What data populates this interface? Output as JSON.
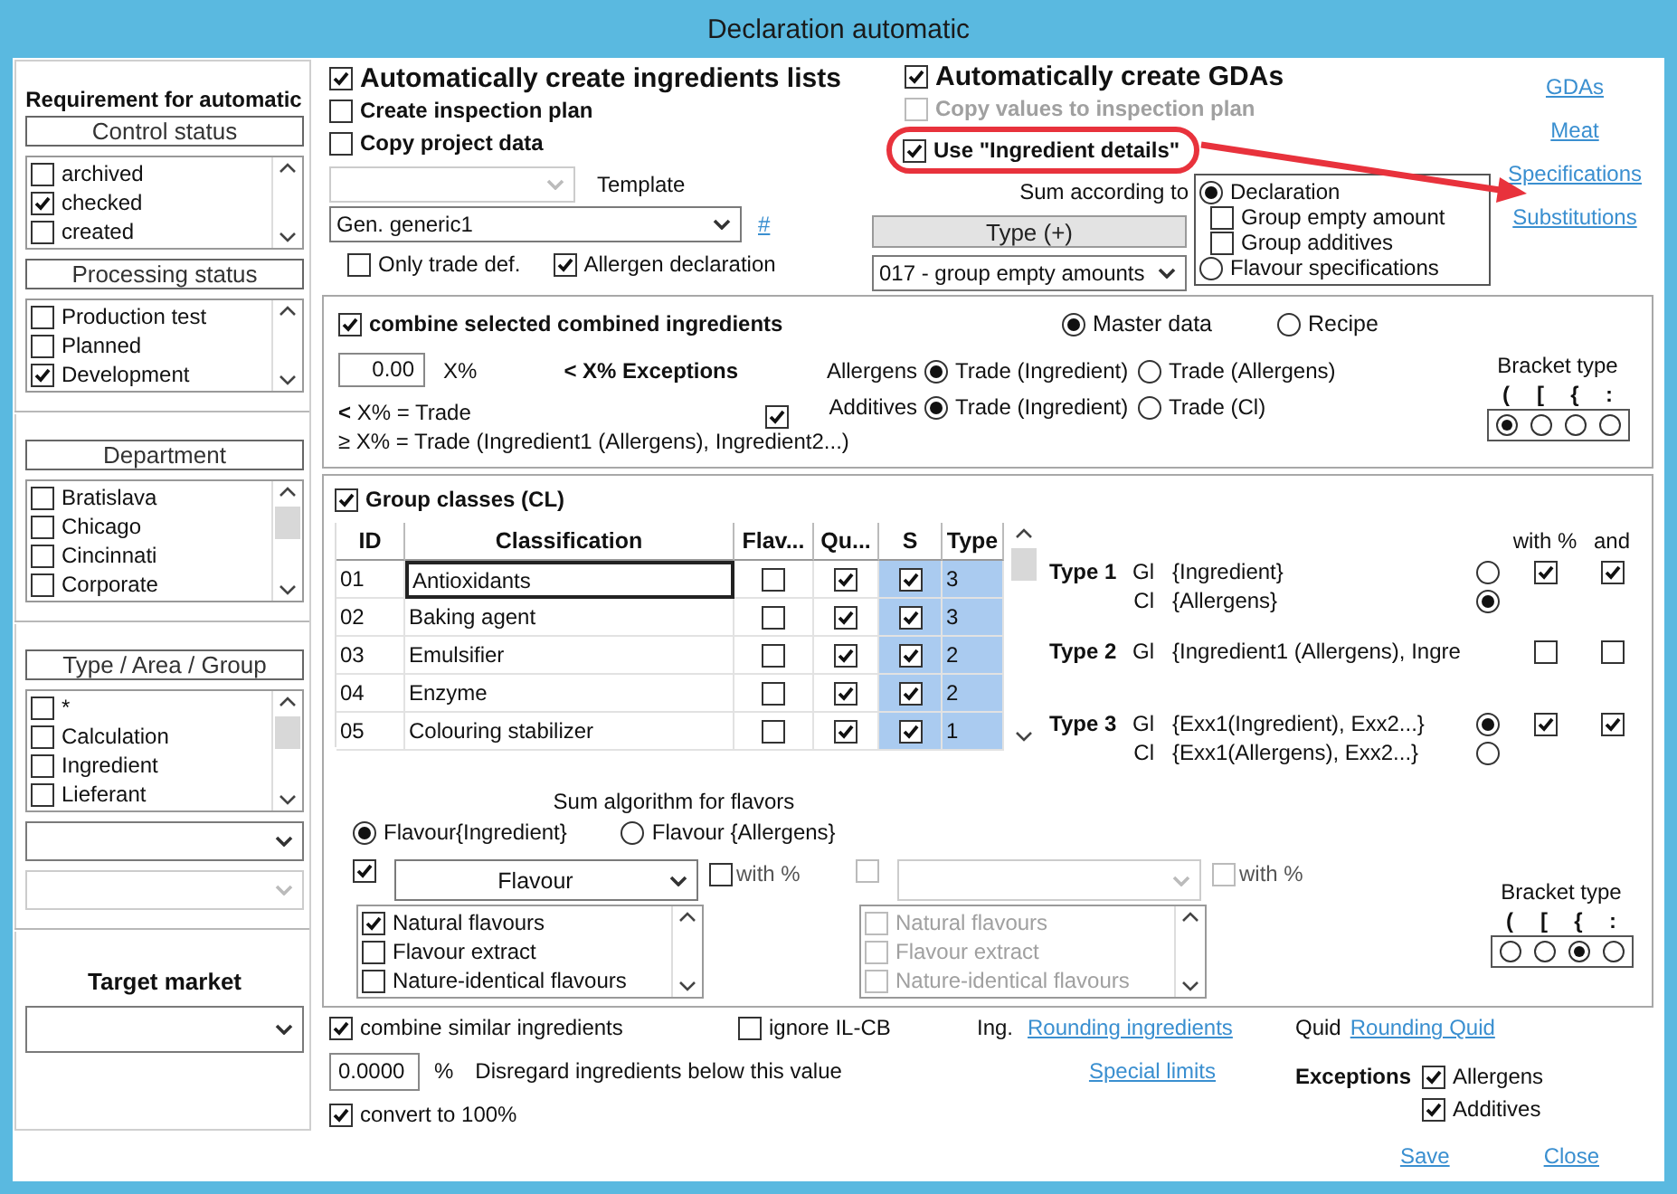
{
  "window": {
    "title": "Declaration automatic"
  },
  "requirements": {
    "title": "Requirement for automatic",
    "sections": [
      {
        "lists": [
          {
            "title": "Control status",
            "items": [
              {
                "label": "archived",
                "checked": false
              },
              {
                "label": "checked",
                "checked": true
              },
              {
                "label": "created",
                "checked": false
              }
            ]
          },
          {
            "title": "Processing status",
            "items": [
              {
                "label": "Production test",
                "checked": false
              },
              {
                "label": "Planned",
                "checked": false
              },
              {
                "label": "Development",
                "checked": true
              }
            ]
          }
        ]
      },
      {
        "lists": [
          {
            "title": "Department",
            "items": [
              {
                "label": "Bratislava",
                "checked": false
              },
              {
                "label": "Chicago",
                "checked": false
              },
              {
                "label": "Cincinnati",
                "checked": false
              },
              {
                "label": "Corporate",
                "checked": false
              }
            ]
          }
        ]
      },
      {
        "lists": [
          {
            "title": "Type / Area / Group",
            "items": [
              {
                "label": "*",
                "checked": false
              },
              {
                "label": "Calculation",
                "checked": false
              },
              {
                "label": "Ingredient",
                "checked": false
              },
              {
                "label": "Lieferant",
                "checked": false
              }
            ]
          }
        ],
        "dropdowns": [
          {
            "disabled": false
          },
          {
            "disabled": true
          }
        ]
      }
    ],
    "target_market": {
      "title": "Target market"
    }
  },
  "general": {
    "create_options": [
      {
        "label": "Automatically create ingredients lists",
        "checked": true,
        "kind": "primary"
      },
      {
        "label": "Create inspection plan",
        "checked": false,
        "kind": "secondary"
      },
      {
        "label": "Copy project data",
        "checked": false,
        "kind": "secondary"
      }
    ],
    "template": {
      "label": "Template",
      "disabled": true
    },
    "template_select": {
      "value": "Gen. generic1",
      "link": "#"
    },
    "flags": [
      {
        "label": "Only trade def.",
        "checked": false
      },
      {
        "label": "Allergen declaration",
        "checked": true
      }
    ],
    "gda_options": [
      {
        "label": "Automatically create GDAs",
        "checked": true,
        "disabled": false,
        "highlighted": false,
        "kind": "primary"
      },
      {
        "label": "Copy values to inspection plan",
        "checked": false,
        "disabled": true,
        "highlighted": false,
        "kind": "secondary"
      },
      {
        "label": "Use \"Ingredient details\"",
        "checked": true,
        "disabled": false,
        "highlighted": true,
        "kind": "secondary"
      }
    ],
    "sum_according": {
      "label": "Sum according to",
      "options": [
        {
          "kind": "radio",
          "label": "Declaration",
          "selected": true
        },
        {
          "kind": "checkbox",
          "label": "Group empty amount",
          "checked": false
        },
        {
          "kind": "checkbox",
          "label": "Group additives",
          "checked": false
        },
        {
          "kind": "radio",
          "label": "Flavour specifications",
          "selected": false
        }
      ]
    },
    "type_button": "Type (+)",
    "type_select": "017 - group empty amounts",
    "links": [
      "GDAs",
      "Meat",
      "Specifications",
      "Substitutions"
    ]
  },
  "combine": {
    "label": "combine selected combined ingredients",
    "checked": true,
    "source": [
      {
        "label": "Master data",
        "selected": true
      },
      {
        "label": "Recipe",
        "selected": false
      }
    ],
    "threshold": {
      "value": "0.00",
      "unit": "X%"
    },
    "exceptions_title": "< X% Exceptions",
    "rules": [
      "**<** X% = Trade",
      "≥ X% = Trade (Ingredient1 (Allergens), Ingredient2...)"
    ],
    "exceptions_checked": true,
    "allocations": [
      {
        "label": "Allergens",
        "options": [
          {
            "label": "Trade (Ingredient)",
            "selected": true
          },
          {
            "label": "Trade (Allergens)",
            "selected": false
          }
        ]
      },
      {
        "label": "Additives",
        "options": [
          {
            "label": "Trade (Ingredient)",
            "selected": true
          },
          {
            "label": "Trade (Cl)",
            "selected": false
          }
        ]
      }
    ],
    "bracket": {
      "title": "Bracket type",
      "options": [
        {
          "label": "(",
          "selected": true
        },
        {
          "label": "[",
          "selected": false
        },
        {
          "label": "{",
          "selected": false
        },
        {
          "label": ":",
          "selected": false
        }
      ]
    }
  },
  "group_classes": {
    "label": "Group classes (CL)",
    "checked": true,
    "table": {
      "columns": [
        "ID",
        "Classification",
        "Flav...",
        "Qu...",
        "S",
        "Type"
      ],
      "rows": [
        {
          "id": "01",
          "classification": "Antioxidants",
          "flavour": false,
          "quid": true,
          "s": true,
          "type": "3",
          "selected": true
        },
        {
          "id": "02",
          "classification": "Baking agent",
          "flavour": false,
          "quid": true,
          "s": true,
          "type": "3",
          "selected": false
        },
        {
          "id": "03",
          "classification": "Emulsifier",
          "flavour": false,
          "quid": true,
          "s": true,
          "type": "2",
          "selected": false
        },
        {
          "id": "04",
          "classification": "Enzyme",
          "flavour": false,
          "quid": true,
          "s": true,
          "type": "2",
          "selected": false
        },
        {
          "id": "05",
          "classification": "Colouring stabilizer",
          "flavour": false,
          "quid": true,
          "s": true,
          "type": "1",
          "selected": false
        }
      ]
    },
    "type_rules": {
      "headers": [
        "with %",
        "and"
      ],
      "types": [
        {
          "label": "Type 1",
          "lines": [
            {
              "code": "Gl",
              "text": "{Ingredient}",
              "selected": false,
              "with_percent": true,
              "and": true
            },
            {
              "code": "Cl",
              "text": "{Allergens}",
              "selected": true
            }
          ]
        },
        {
          "label": "Type 2",
          "lines": [
            {
              "code": "Gl",
              "text": "{Ingredient1 (Allergens), Ingre",
              "with_percent": false,
              "and": false
            }
          ]
        },
        {
          "label": "Type 3",
          "lines": [
            {
              "code": "Gl",
              "text": "{Exx1(Ingredient), Exx2...}",
              "selected": true,
              "with_percent": true,
              "and": true
            },
            {
              "code": "Cl",
              "text": "{Exx1(Allergens), Exx2...}",
              "selected": false
            }
          ]
        }
      ]
    }
  },
  "flavours": {
    "title": "Sum algorithm for flavors",
    "algorithm": [
      {
        "label": "Flavour{Ingredient}",
        "selected": true
      },
      {
        "label": "Flavour {Allergens}",
        "selected": false
      }
    ],
    "columns": [
      {
        "checked": true,
        "disabled": false,
        "value": "Flavour",
        "with_percent": {
          "label": "with %",
          "checked": false
        },
        "items": [
          {
            "label": "Natural flavours",
            "checked": true
          },
          {
            "label": "Flavour extract",
            "checked": false
          },
          {
            "label": "Nature-identical flavours",
            "checked": false
          }
        ]
      },
      {
        "checked": false,
        "disabled": true,
        "with_percent": {
          "label": "with %",
          "checked": false
        },
        "items": [
          {
            "label": "Natural flavours",
            "checked": false
          },
          {
            "label": "Flavour extract",
            "checked": false
          },
          {
            "label": "Nature-identical flavours",
            "checked": false
          }
        ]
      }
    ],
    "bracket": {
      "title": "Bracket type",
      "options": [
        {
          "label": "(",
          "selected": false
        },
        {
          "label": "[",
          "selected": false
        },
        {
          "label": "{",
          "selected": true
        },
        {
          "label": ":",
          "selected": false
        }
      ]
    }
  },
  "bottom": {
    "options": [
      {
        "label": "combine similar ingredients",
        "checked": true
      },
      {
        "label": "ignore IL-CB",
        "checked": false
      }
    ],
    "rounding": [
      {
        "label": "Ing.",
        "link": "Rounding ingredients"
      },
      {
        "label": "Quid",
        "link": "Rounding Quid"
      }
    ],
    "disregard": {
      "value": "0.0000",
      "unit": "%",
      "label": "Disregard ingredients below this value"
    },
    "special_link": "Special limits",
    "exceptions": {
      "title": "Exceptions",
      "items": [
        {
          "label": "Allergens",
          "checked": true
        },
        {
          "label": "Additives",
          "checked": true
        }
      ]
    },
    "convert": {
      "label": "convert to 100%",
      "checked": true
    }
  },
  "actions": [
    "Save",
    "Close"
  ]
}
